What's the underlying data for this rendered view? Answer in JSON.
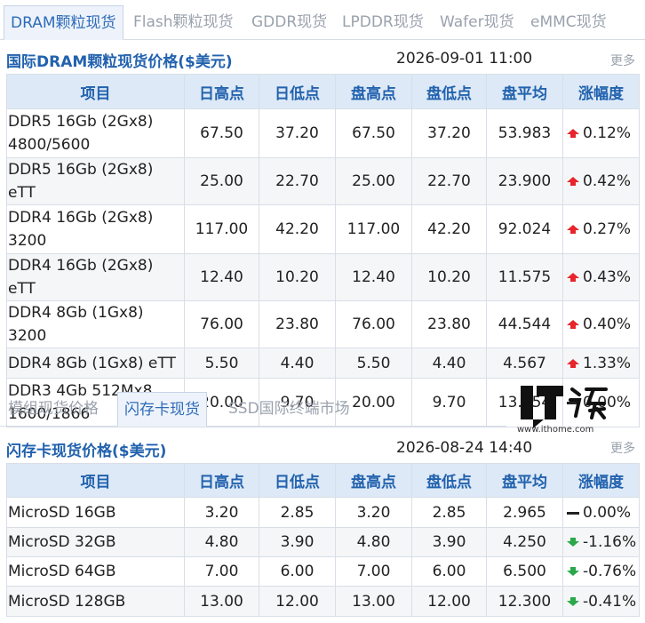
{
  "top_tabs": [
    "DRAM颗粒现货",
    "Flash颗粒现货",
    "GDDR现货",
    "LPDDR现货",
    "Wafer现货",
    "eMMC现货"
  ],
  "dram": {
    "title": "国际DRAM颗粒现货价格($美元)",
    "timestamp": "2026-09-01 11:00",
    "more": "更多",
    "headers": [
      "项目",
      "日高点",
      "日低点",
      "盘高点",
      "盘低点",
      "盘平均",
      "涨幅度"
    ],
    "rows": [
      {
        "name": "DDR5 16Gb (2Gx8) 4800/5600",
        "day_high": "67.50",
        "day_low": "37.20",
        "session_high": "67.50",
        "session_low": "37.20",
        "session_avg": "53.983",
        "change": "0.12%",
        "trend": "up"
      },
      {
        "name": "DDR5 16Gb (2Gx8) eTT",
        "day_high": "25.00",
        "day_low": "22.70",
        "session_high": "25.00",
        "session_low": "22.70",
        "session_avg": "23.900",
        "change": "0.42%",
        "trend": "up"
      },
      {
        "name": "DDR4 16Gb (2Gx8) 3200",
        "day_high": "117.00",
        "day_low": "42.20",
        "session_high": "117.00",
        "session_low": "42.20",
        "session_avg": "92.024",
        "change": "0.27%",
        "trend": "up"
      },
      {
        "name": "DDR4 16Gb (2Gx8) eTT",
        "day_high": "12.40",
        "day_low": "10.20",
        "session_high": "12.40",
        "session_low": "10.20",
        "session_avg": "11.575",
        "change": "0.43%",
        "trend": "up"
      },
      {
        "name": "DDR4 8Gb (1Gx8) 3200",
        "day_high": "76.00",
        "day_low": "23.80",
        "session_high": "76.00",
        "session_low": "23.80",
        "session_avg": "44.544",
        "change": "0.40%",
        "trend": "up"
      },
      {
        "name": "DDR4 8Gb (1Gx8) eTT",
        "day_high": "5.50",
        "day_low": "4.40",
        "session_high": "5.50",
        "session_low": "4.40",
        "session_avg": "4.567",
        "change": "1.33%",
        "trend": "up"
      },
      {
        "name": "DDR3 4Gb 512Mx8 1600/1866",
        "day_high": "20.00",
        "day_low": "9.70",
        "session_high": "20.00",
        "session_low": "9.70",
        "session_avg": "13.854",
        "change": "0.00%",
        "trend": "flat"
      }
    ]
  },
  "lower_tabs": [
    "模组现货价格",
    "闪存卡现货",
    "SSD国际终端市场"
  ],
  "logo": {
    "text": "IT之家",
    "url": "www.ithome.com"
  },
  "flash": {
    "title": "闪存卡现货价格($美元)",
    "timestamp": "2026-08-24 14:40",
    "more": "更多",
    "headers": [
      "项目",
      "日高点",
      "日低点",
      "盘高点",
      "盘低点",
      "盘平均",
      "涨幅度"
    ],
    "rows": [
      {
        "name": "MicroSD 16GB",
        "day_high": "3.20",
        "day_low": "2.85",
        "session_high": "3.20",
        "session_low": "2.85",
        "session_avg": "2.965",
        "change": "0.00%",
        "trend": "flat"
      },
      {
        "name": "MicroSD 32GB",
        "day_high": "4.80",
        "day_low": "3.90",
        "session_high": "4.80",
        "session_low": "3.90",
        "session_avg": "4.250",
        "change": "-1.16%",
        "trend": "down"
      },
      {
        "name": "MicroSD 64GB",
        "day_high": "7.00",
        "day_low": "6.00",
        "session_high": "7.00",
        "session_low": "6.00",
        "session_avg": "6.500",
        "change": "-0.76%",
        "trend": "down"
      },
      {
        "name": "MicroSD 128GB",
        "day_high": "13.00",
        "day_low": "12.00",
        "session_high": "13.00",
        "session_low": "12.00",
        "session_avg": "12.300",
        "change": "-0.41%",
        "trend": "down"
      }
    ]
  },
  "colors": {
    "up": "#e6262b",
    "down": "#2aa84a",
    "flat": "#222222",
    "accent": "#2262ae"
  }
}
